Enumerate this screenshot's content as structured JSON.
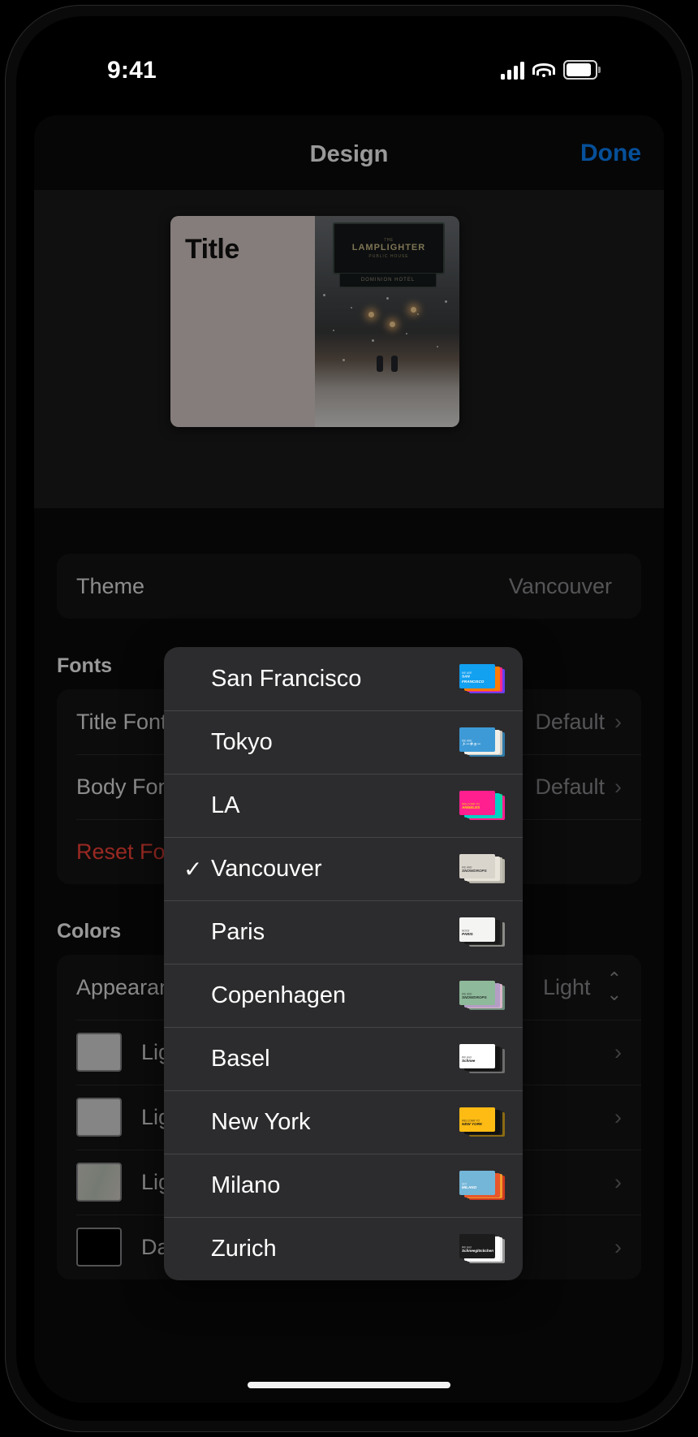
{
  "status_bar": {
    "time": "9:41",
    "cellular": "signal-bars",
    "wifi": "wifi-icon",
    "battery": "battery-icon"
  },
  "nav": {
    "title": "Design",
    "done_label": "Done"
  },
  "preview": {
    "title_text": "Title",
    "left_bg": "#ded1cd",
    "photo_sign_line1": "THE",
    "photo_sign_line2": "LAMPLIGHTER",
    "photo_sign_line3": "PUBLIC HOUSE",
    "photo_sign_sub": "DOMINION HOTEL"
  },
  "theme_row": {
    "label": "Theme",
    "value": "Vancouver"
  },
  "fonts": {
    "header": "Fonts",
    "rows": [
      {
        "label": "Title Font",
        "value": "Default",
        "chevron": "›"
      },
      {
        "label": "Body Font",
        "value": "Default",
        "chevron": "›"
      }
    ],
    "reset_label": "Reset Fonts"
  },
  "colors": {
    "header": "Colors",
    "appearance": {
      "label": "Appearance",
      "value": "Light",
      "stepper": "⌃⌄"
    },
    "rows": [
      {
        "label": "Light Background",
        "swatch": "#dedede",
        "chevron": "›"
      },
      {
        "label": "Light Text",
        "swatch": "#dedede",
        "chevron": "›"
      },
      {
        "label": "Light Title",
        "swatch": "#c9cfc6",
        "chevron": "›"
      },
      {
        "label": "Dark Title",
        "swatch": "#000000",
        "chevron": "›"
      }
    ]
  },
  "menu": {
    "selected": "Vancouver",
    "checkmark": "✓",
    "items": [
      {
        "label": "San Francisco",
        "selected": false,
        "thumb": {
          "front": "#12a0f0",
          "back1": "#ff7a00",
          "back2": "#ff2d8a",
          "back3": "#6b3df0",
          "top": "WE ARE",
          "main": "SAN FRANCISCO",
          "text_color": "#ffffff"
        }
      },
      {
        "label": "Tokyo",
        "selected": false,
        "thumb": {
          "front": "#3e9ad6",
          "back1": "#f1efe8",
          "back2": "#c9c6bd",
          "back3": "#2f7aa8",
          "top": "WE ARE",
          "main": "トーキョー",
          "text_color": "#ffffff"
        }
      },
      {
        "label": "LA",
        "selected": false,
        "thumb": {
          "front": "#ff1f8e",
          "back1": "#00d2c8",
          "back2": "#0fd6a0",
          "back3": "#ff1f8e",
          "top": "WELCOME TO",
          "main": "ANGELES",
          "text_color": "#ffe600"
        }
      },
      {
        "label": "Vancouver",
        "selected": true,
        "thumb": {
          "front": "#d9d4cc",
          "back1": "#e8e4da",
          "back2": "#c3c0b5",
          "back3": "#b5b2a6",
          "top": "WE ARE",
          "main": "SNOWDROPS",
          "text_color": "#3a3a38"
        }
      },
      {
        "label": "Paris",
        "selected": false,
        "thumb": {
          "front": "#f4f4f2",
          "back1": "#1b1b1b",
          "back2": "#2a2a2a",
          "back3": "#8b8b87",
          "top": "NOUS",
          "main": "PARIS",
          "text_color": "#1a1a1a"
        }
      },
      {
        "label": "Copenhagen",
        "selected": false,
        "thumb": {
          "front": "#8fb99b",
          "back1": "#b49ec6",
          "back2": "#d9b6c8",
          "back3": "#6f8f7c",
          "top": "WE ARE",
          "main": "SNOWDROPS",
          "text_color": "#27352c"
        }
      },
      {
        "label": "Basel",
        "selected": false,
        "thumb": {
          "front": "#ffffff",
          "back1": "#141414",
          "back2": "#1f1f1f",
          "back3": "#6d6d6d",
          "top": "Wir sind",
          "main": "Schnee",
          "text_color": "#111111"
        }
      },
      {
        "label": "New York",
        "selected": false,
        "thumb": {
          "front": "#fdbb13",
          "back1": "#121212",
          "back2": "#1c1c1c",
          "back3": "#8a6a12",
          "top": "WELCOME TO",
          "main": "NEW YORK",
          "text_color": "#1a1a1a"
        }
      },
      {
        "label": "Milano",
        "selected": false,
        "thumb": {
          "front": "#74b6d8",
          "back1": "#e8562a",
          "back2": "#f29b2a",
          "back3": "#d13a1f",
          "top": "NOI",
          "main": "MILANO",
          "text_color": "#ffffff"
        }
      },
      {
        "label": "Zurich",
        "selected": false,
        "thumb": {
          "front": "#1c1c1c",
          "back1": "#ffffff",
          "back2": "#f0f0f0",
          "back3": "#9a9a9a",
          "top": "Wir sind",
          "main": "Schneeglöckchen",
          "text_color": "#ffffff"
        }
      }
    ]
  },
  "accent_blue": "#0a84ff",
  "destructive_red": "#ff453a"
}
